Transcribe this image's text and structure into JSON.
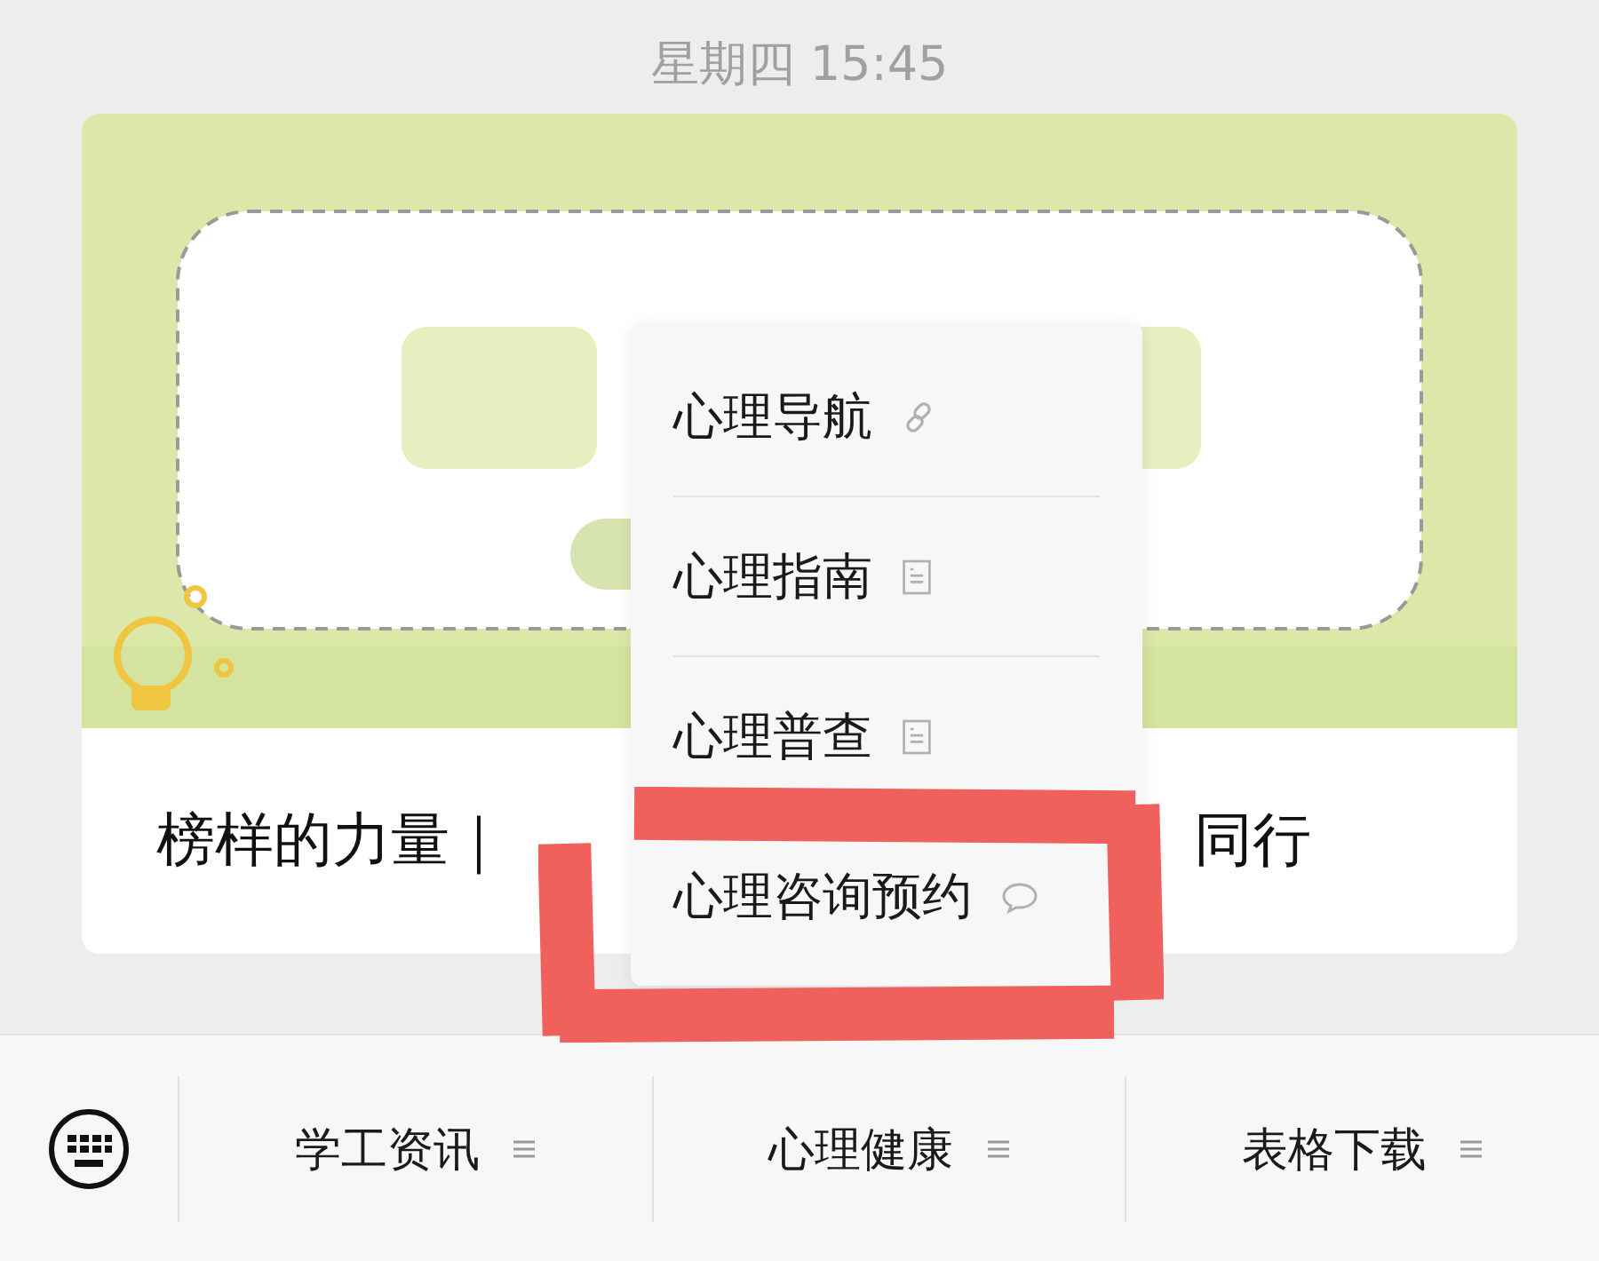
{
  "status_time": "星期四 15:45",
  "article": {
    "title_start": "榜样的力量｜",
    "title_end": "同行"
  },
  "popup_menu": [
    {
      "label": "心理导航",
      "kind": "link"
    },
    {
      "label": "心理指南",
      "kind": "doc"
    },
    {
      "label": "心理普查",
      "kind": "doc"
    },
    {
      "label": "心理咨询预约",
      "kind": "chat"
    }
  ],
  "bottom_menu": [
    {
      "label": "学工资讯"
    },
    {
      "label": "心理健康"
    },
    {
      "label": "表格下载"
    }
  ]
}
